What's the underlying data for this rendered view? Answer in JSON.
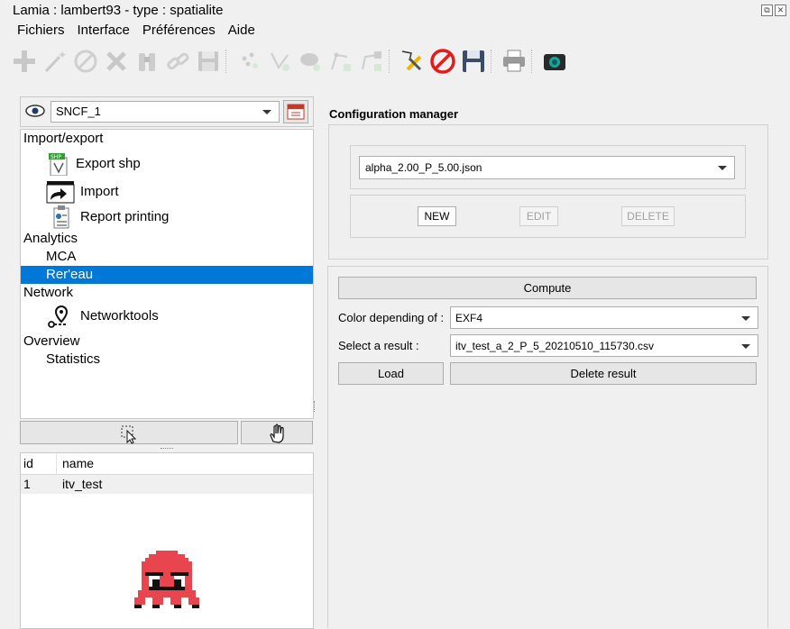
{
  "window": {
    "title": "Lamia : lambert93 - type : spatialite",
    "buttons": [
      "⧉",
      "✕"
    ]
  },
  "menu": {
    "items": [
      "Fichiers",
      "Interface",
      "Préférences",
      "Aide"
    ]
  },
  "toolbar": {
    "icons": [
      "add-icon",
      "magic-wand-icon",
      "cancel-circle-icon",
      "delete-x-icon",
      "binoculars-icon",
      "link-icon",
      "save-disabled-icon",
      "points-icon",
      "node-add-icon",
      "shape-add-icon",
      "line-add-icon",
      "network-add-icon",
      "edit-tools-icon",
      "stop-icon",
      "save-icon",
      "print-icon",
      "camera-icon"
    ]
  },
  "left": {
    "layer_combo": {
      "value": "SNCF_1"
    },
    "tree": {
      "items": [
        {
          "label": "Import/export",
          "level": 0
        },
        {
          "label": "Export shp",
          "level": 1,
          "icon": "shp-export-icon"
        },
        {
          "label": "Import",
          "level": 1,
          "icon": "import-arrow-icon"
        },
        {
          "label": "Report printing",
          "level": 1,
          "icon": "report-icon"
        },
        {
          "label": "Analytics",
          "level": 0
        },
        {
          "label": "MCA",
          "level": 1
        },
        {
          "label": "Rer'eau",
          "level": 1,
          "selected": true
        },
        {
          "label": "Network",
          "level": 0
        },
        {
          "label": "Networktools",
          "level": 1,
          "icon": "network-pin-icon"
        },
        {
          "label": "Overview",
          "level": 0
        },
        {
          "label": "Statistics",
          "level": 1
        }
      ]
    },
    "table": {
      "headers": [
        "id",
        "name"
      ],
      "rows": [
        {
          "id": "1",
          "name": "itv_test"
        }
      ]
    }
  },
  "right": {
    "config": {
      "title": "Configuration manager",
      "file_value": "alpha_2.00_P_5.00.json",
      "new_label": "NEW",
      "edit_label": "EDIT",
      "delete_label": "DELETE"
    },
    "compute_label": "Compute",
    "color_label": "Color depending of :",
    "color_value": "EXF4",
    "result_label": "Select a result :",
    "result_value": "itv_test_a_2_P_5_20210510_115730.csv",
    "load_label": "Load",
    "delete_result_label": "Delete result"
  },
  "colors": {
    "selection": "#0078d7",
    "mascot": "#e8454e"
  }
}
